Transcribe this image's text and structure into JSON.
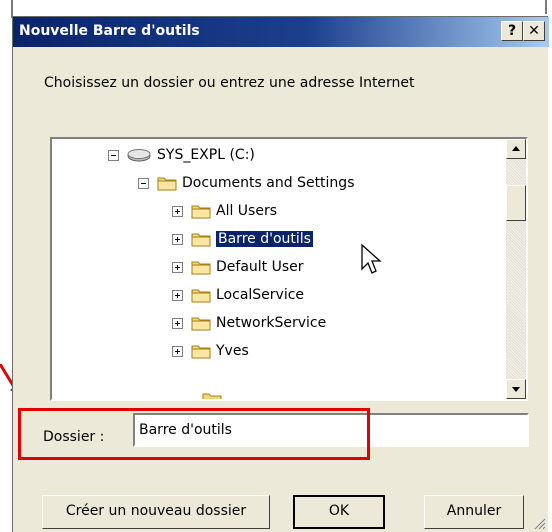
{
  "window": {
    "title": "Nouvelle Barre d'outils",
    "help_label": "?",
    "close_label": "✕"
  },
  "instruction": "Choisissez un dossier ou entrez une adresse Internet",
  "tree": {
    "items": [
      {
        "label": "SYS_EXPL (C:)",
        "icon": "drive-icon",
        "expanded": true,
        "selected": false
      },
      {
        "label": "Documents and Settings",
        "icon": "folder-icon",
        "expanded": true,
        "selected": false
      },
      {
        "label": "All Users",
        "icon": "folder-icon",
        "expanded": false,
        "selected": false
      },
      {
        "label": "Barre d'outils",
        "icon": "folder-icon",
        "expanded": false,
        "selected": true
      },
      {
        "label": "Default User",
        "icon": "folder-icon",
        "expanded": false,
        "selected": false
      },
      {
        "label": "LocalService",
        "icon": "folder-icon",
        "expanded": false,
        "selected": false
      },
      {
        "label": "NetworkService",
        "icon": "folder-icon",
        "expanded": false,
        "selected": false
      },
      {
        "label": "Yves",
        "icon": "folder-icon",
        "expanded": false,
        "selected": false
      }
    ]
  },
  "folder_field": {
    "label": "Dossier :",
    "value": "Barre d'outils"
  },
  "buttons": {
    "new_folder": "Créer un nouveau dossier",
    "ok": "OK",
    "cancel": "Annuler"
  },
  "colors": {
    "title_start": "#0a246a",
    "selection": "#0a246a",
    "highlight_box": "#e00000",
    "dialog_bg": "#ece9d8"
  }
}
